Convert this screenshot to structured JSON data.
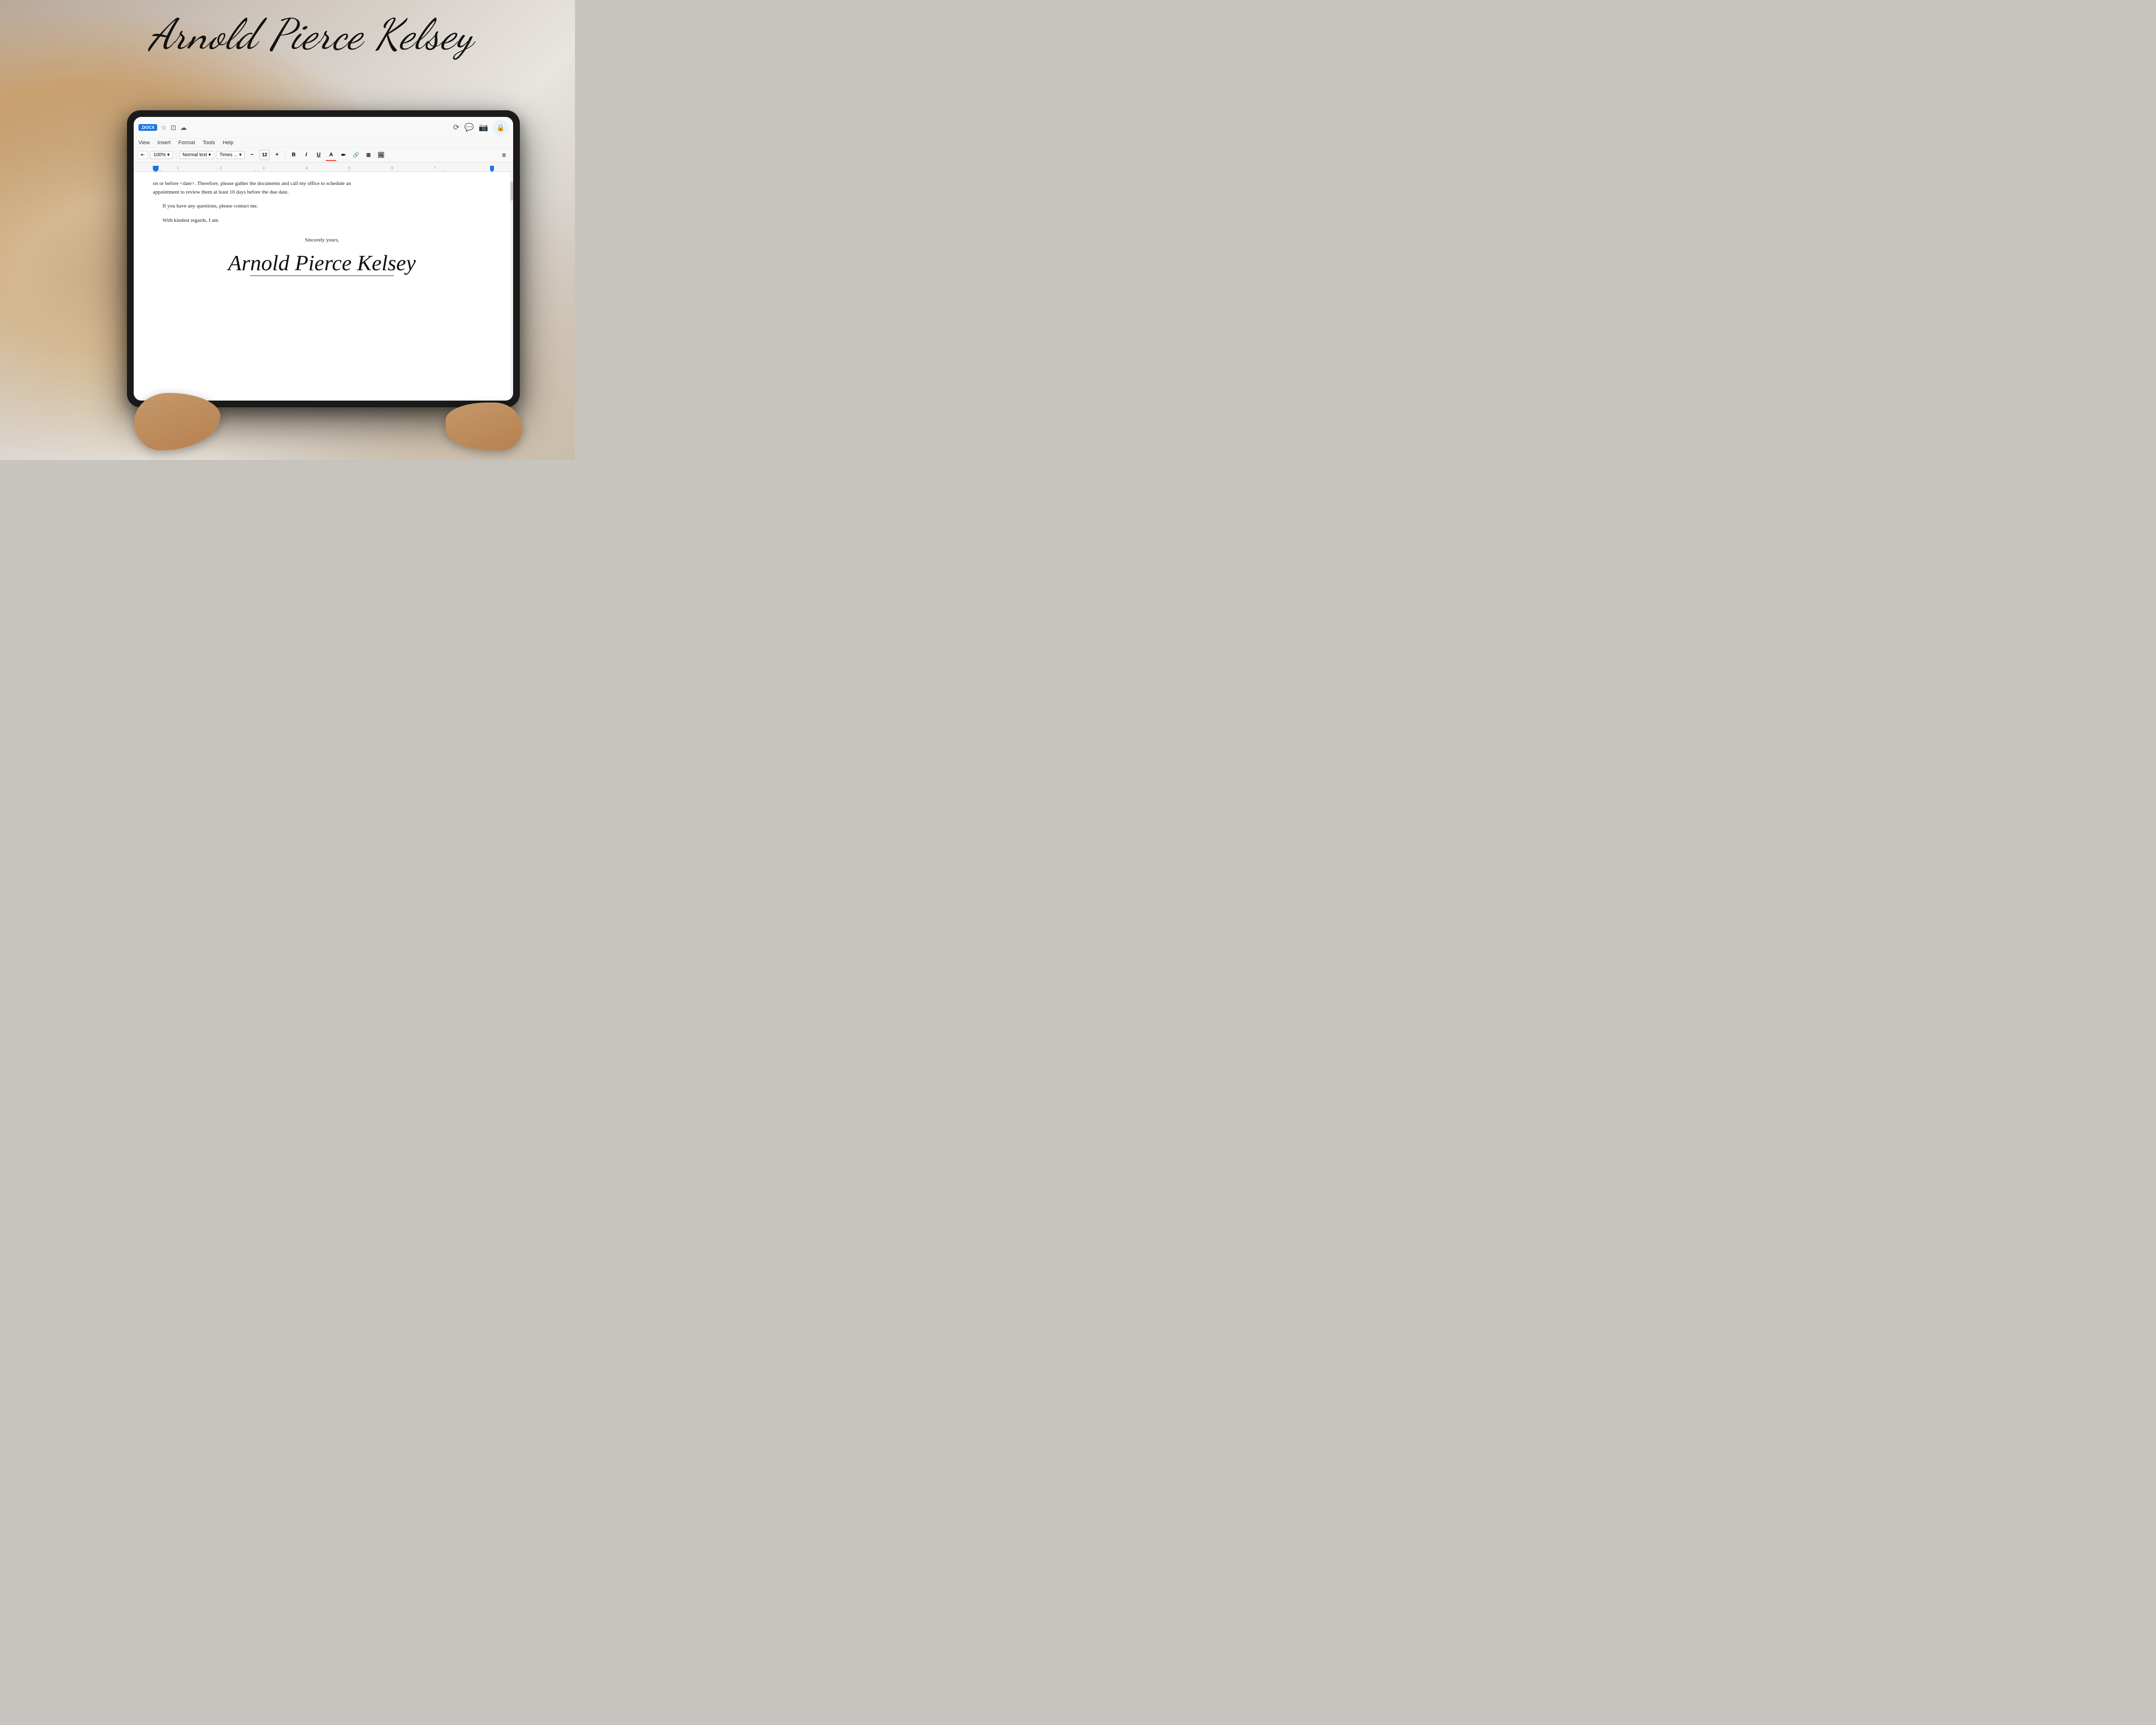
{
  "page": {
    "title": "Arnold Pierce Kelsey",
    "background": {
      "description": "Blurred photo background of person holding tablet"
    }
  },
  "top_signature": {
    "text": "Arnold Pierce Kelsey"
  },
  "tablet": {
    "toolbar_top": {
      "docx_badge": ".DOCX",
      "icons": [
        "star",
        "folder",
        "cloud"
      ],
      "right_icons": [
        "history",
        "comment",
        "camera",
        "lock"
      ]
    },
    "menu_bar": {
      "items": [
        "View",
        "Insert",
        "Format",
        "Tools",
        "Help"
      ]
    },
    "formatting_bar": {
      "zoom": "100%",
      "style": "Normal text",
      "font": "Times ...",
      "minus": "−",
      "size": "12",
      "plus": "+",
      "bold": "B",
      "italic": "I",
      "underline": "U",
      "color": "A",
      "highlight": "✏",
      "link": "🔗",
      "more1": "+",
      "image": "🖼"
    },
    "ruler": {
      "numbers": [
        "1",
        "2",
        "3",
        "4",
        "5",
        "6",
        "7"
      ]
    },
    "document": {
      "line1": "on or before <date>.  Therefore, please gather the documents and call my office to schedule an",
      "line2": "appointment to review them at least 10 days before the due date.",
      "para1": "If you have any questions, please contact me.",
      "para2": "With kindest regards, I am",
      "closing": "Sincerely yours,",
      "signature": "Arnold Pierce Kelsey"
    }
  }
}
